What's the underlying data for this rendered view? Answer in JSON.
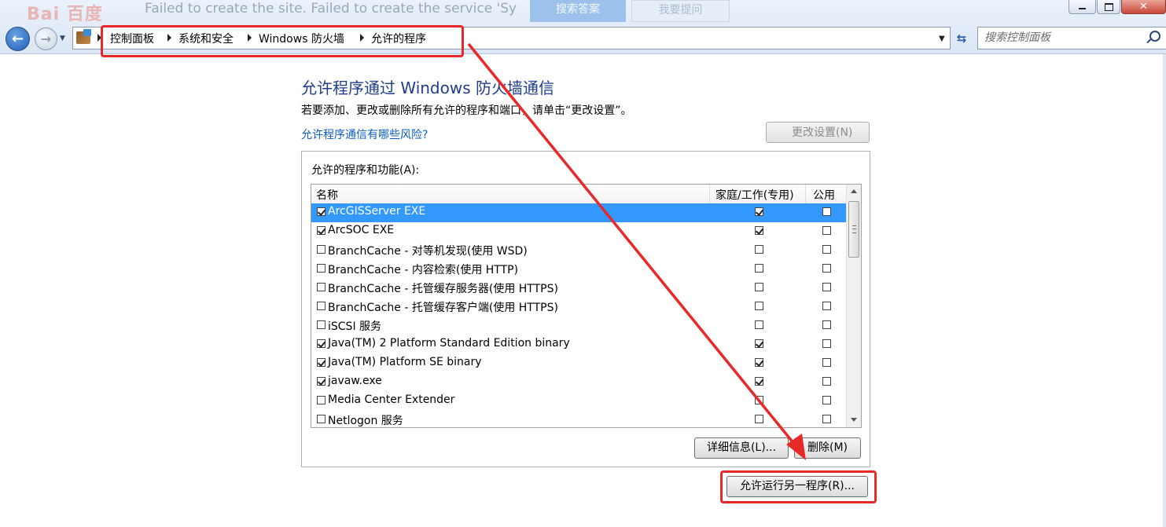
{
  "background_window": {
    "logo_text": "Bai 百度",
    "message": "Failed to create the site. Failed to create the service 'Sy",
    "button1": "搜索答案",
    "button2": "我要提问"
  },
  "address_bar": {
    "crumbs": [
      "控制面板",
      "系统和安全",
      "Windows 防火墙",
      "允许的程序"
    ]
  },
  "search": {
    "placeholder": "搜索控制面板"
  },
  "main": {
    "title": "允许程序通过 Windows 防火墙通信",
    "description": "若要添加、更改或删除所有允许的程序和端口，请单击“更改设置”。",
    "risk_link": "允许程序通信有哪些风险?",
    "change_settings_label": "更改设置(N)",
    "group_label": "允许的程序和功能(A):",
    "columns": {
      "name": "名称",
      "home": "家庭/工作(专用)",
      "public": "公用"
    },
    "programs": [
      {
        "name": "ArcGISServer EXE",
        "enabled": true,
        "home": true,
        "public": false,
        "selected": true
      },
      {
        "name": "ArcSOC EXE",
        "enabled": true,
        "home": true,
        "public": false
      },
      {
        "name": "BranchCache - 对等机发现(使用 WSD)",
        "enabled": false,
        "home": false,
        "public": false
      },
      {
        "name": "BranchCache - 内容检索(使用 HTTP)",
        "enabled": false,
        "home": false,
        "public": false
      },
      {
        "name": "BranchCache - 托管缓存服务器(使用 HTTPS)",
        "enabled": false,
        "home": false,
        "public": false
      },
      {
        "name": "BranchCache - 托管缓存客户端(使用 HTTPS)",
        "enabled": false,
        "home": false,
        "public": false
      },
      {
        "name": "iSCSI 服务",
        "enabled": false,
        "home": false,
        "public": false
      },
      {
        "name": "Java(TM) 2 Platform Standard Edition binary",
        "enabled": true,
        "home": true,
        "public": false
      },
      {
        "name": "Java(TM) Platform SE binary",
        "enabled": true,
        "home": true,
        "public": false
      },
      {
        "name": "javaw.exe",
        "enabled": true,
        "home": true,
        "public": false
      },
      {
        "name": "Media Center Extender",
        "enabled": false,
        "home": false,
        "public": false
      },
      {
        "name": "Netlogon 服务",
        "enabled": false,
        "home": false,
        "public": false
      }
    ],
    "details_label": "详细信息(L)...",
    "delete_label": "删除(M)",
    "allow_another_label": "允许运行另一程序(R)..."
  },
  "annotation_color": "#e8292a",
  "accent_color": "#3399ff"
}
